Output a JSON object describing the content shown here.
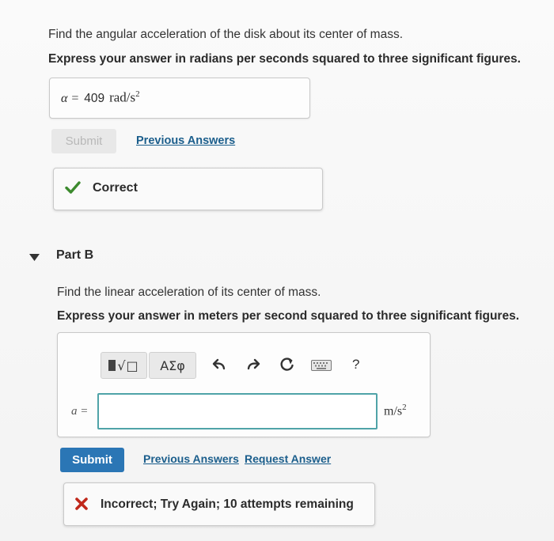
{
  "partA": {
    "question": "Find the angular acceleration of the disk about its center of mass.",
    "instruction": "Express your answer in radians per seconds squared to three significant figures.",
    "answer": {
      "variable": "α =",
      "value": "409",
      "unit_base": "rad/s",
      "unit_exp": "2"
    },
    "submit_label": "Submit",
    "previous_answers_label": "Previous Answers",
    "feedback": {
      "icon": "check-icon",
      "text": "Correct",
      "color": "#3c8a2e"
    }
  },
  "partB": {
    "title": "Part B",
    "question": "Find the linear acceleration of its center of mass.",
    "instruction": "Express your answer in meters per second squared to three significant figures.",
    "toolbar": {
      "templates_label": "√□",
      "greek_label": "ΑΣφ",
      "undo_icon": "undo-icon",
      "redo_icon": "redo-icon",
      "reset_icon": "reset-icon",
      "keyboard_icon": "keyboard-icon",
      "help_label": "?"
    },
    "answer": {
      "variable": "a =",
      "value": "",
      "unit_base": "m/s",
      "unit_exp": "2"
    },
    "submit_label": "Submit",
    "previous_answers_label": "Previous Answers",
    "request_answer_label": "Request Answer",
    "feedback": {
      "icon": "x-icon",
      "text": "Incorrect; Try Again; 10 attempts remaining",
      "color": "#c0281b"
    }
  },
  "colors": {
    "accent": "#2b76b5",
    "link": "#1b5e8c",
    "focus_border": "#4fa3a8"
  }
}
